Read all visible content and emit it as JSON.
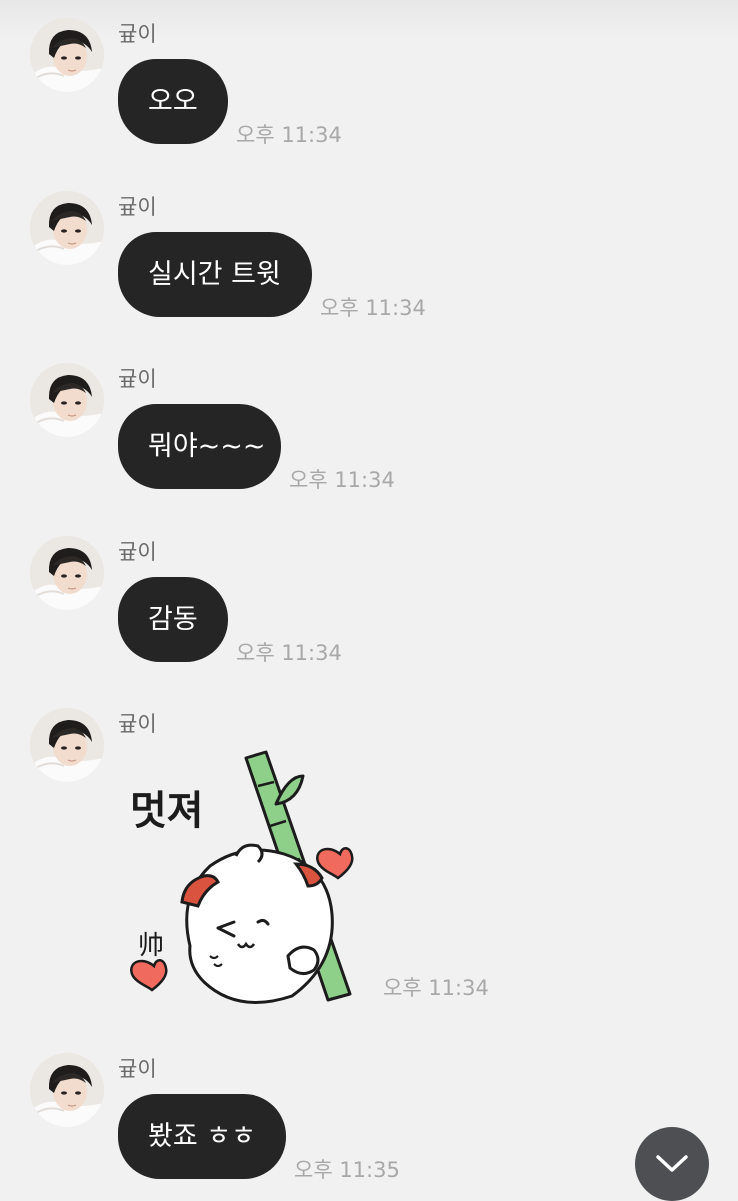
{
  "messages": [
    {
      "sender": "귶이",
      "text": "오오",
      "time": "오후 11:34"
    },
    {
      "sender": "귶이",
      "text": "실시간 트윗",
      "time": "오후 11:34"
    },
    {
      "sender": "귶이",
      "text": "뭐야~~~",
      "time": "오후 11:34"
    },
    {
      "sender": "귶이",
      "text": "감동",
      "time": "오후 11:34"
    },
    {
      "sender": "귶이",
      "sticker": {
        "text": "멋져",
        "side_text": "帅"
      },
      "time": "오후 11:34"
    },
    {
      "sender": "귶이",
      "text": "봤죠 ㅎㅎ",
      "time": "오후 11:35"
    }
  ],
  "colors": {
    "background": "#f1f1f1",
    "bubble": "#252525",
    "bubble_text": "#ffffff",
    "time_text": "#a8a8a8",
    "sender_text": "#6b6b6b",
    "heart": "#f06a5e",
    "bamboo": "#8ed08a"
  },
  "icons": {
    "scroll_down": "chevron-down-icon"
  }
}
